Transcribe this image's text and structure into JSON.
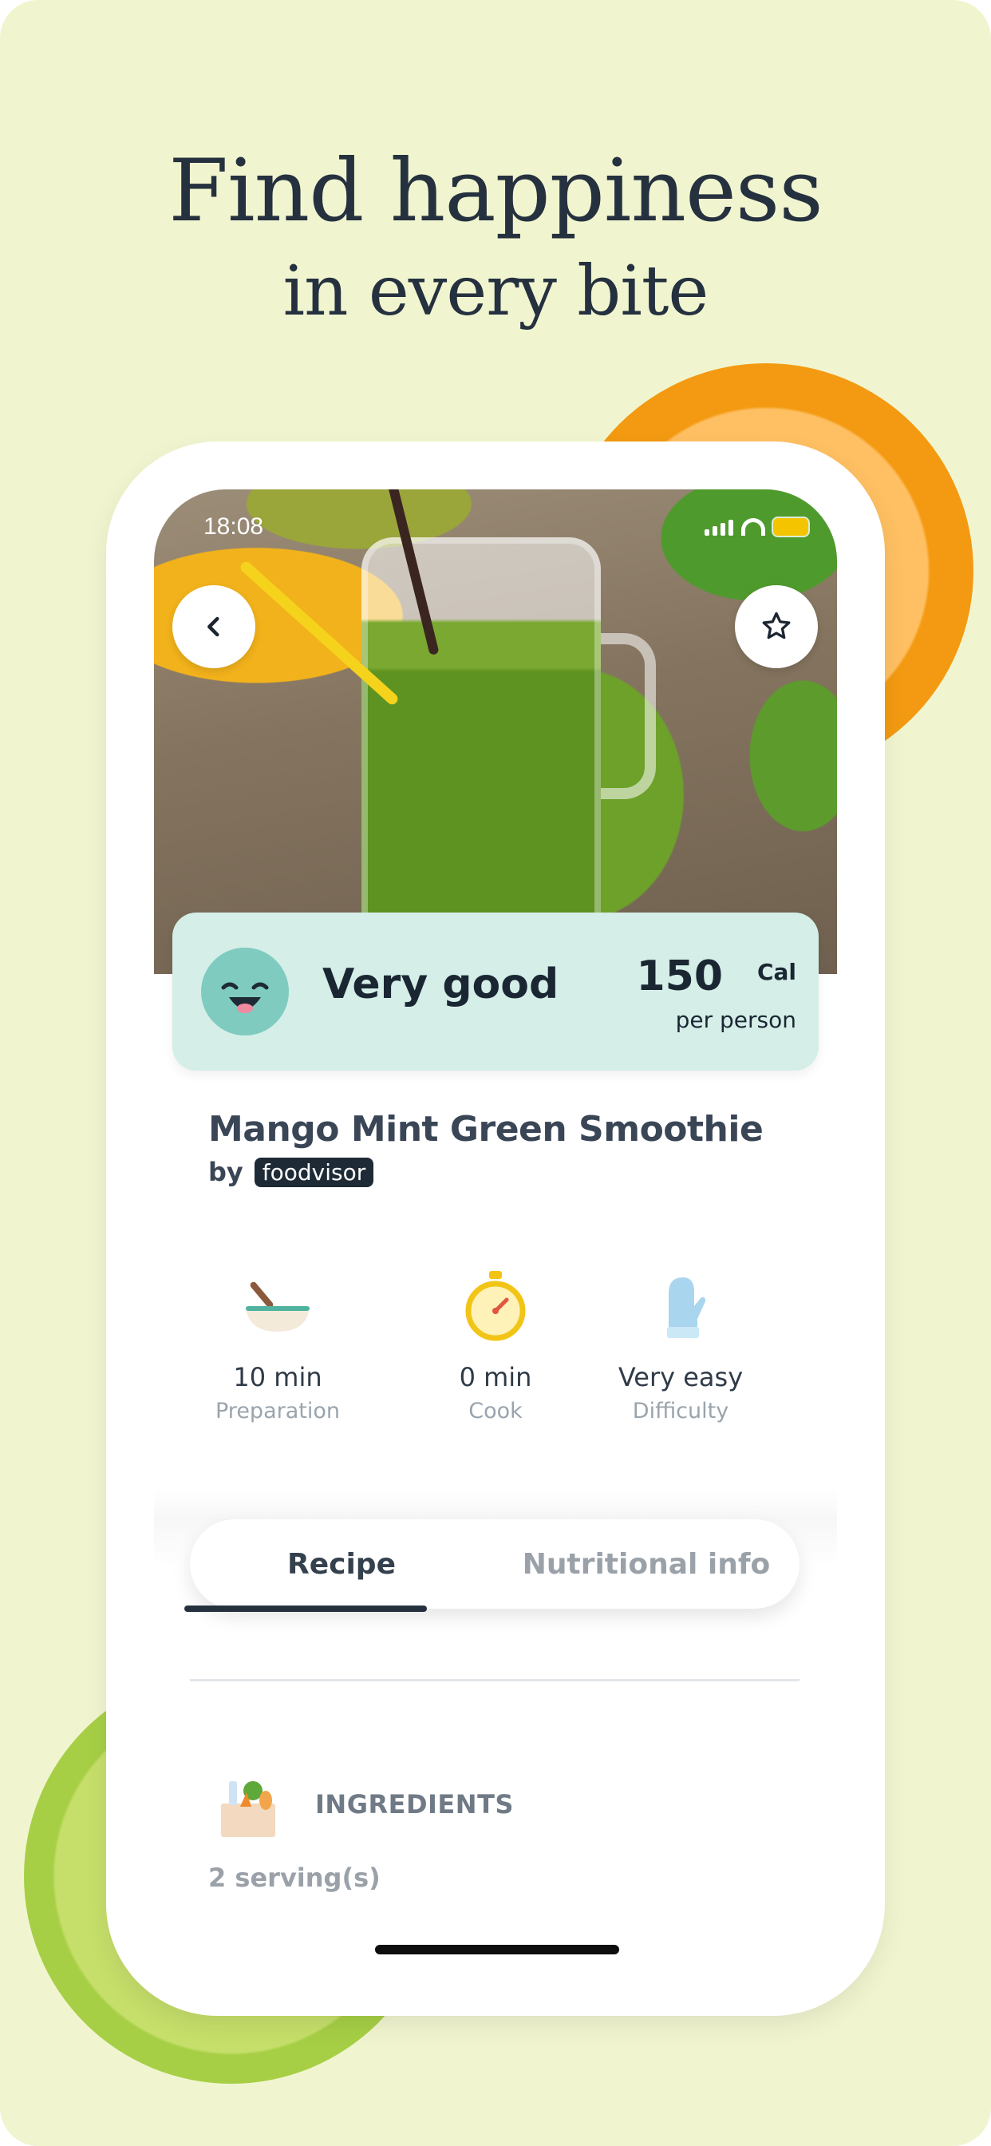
{
  "headline": {
    "line1": "Find happiness",
    "line2": "in every bite"
  },
  "status_bar": {
    "time": "18:08"
  },
  "recipe": {
    "score_label": "Very good",
    "calories": "150",
    "calorie_unit": "Cal",
    "calorie_basis": "per person",
    "title": "Mango Mint Green Smoothie",
    "by": "by",
    "brand": "foodvisor"
  },
  "meta": [
    {
      "value": "10 min",
      "label": "Preparation",
      "icon": "bowl-icon"
    },
    {
      "value": "0 min",
      "label": "Cook",
      "icon": "timer-icon"
    },
    {
      "value": "Very easy",
      "label": "Difficulty",
      "icon": "oven-mitt-icon"
    }
  ],
  "tabs": {
    "recipe": "Recipe",
    "nutritional": "Nutritional info",
    "active": "recipe"
  },
  "ingredients": {
    "heading": "INGREDIENTS",
    "servings": "2 serving(s)"
  },
  "colors": {
    "background": "#f1f5cf",
    "score_card": "#d5eee8",
    "accent_dark": "#25313f"
  }
}
